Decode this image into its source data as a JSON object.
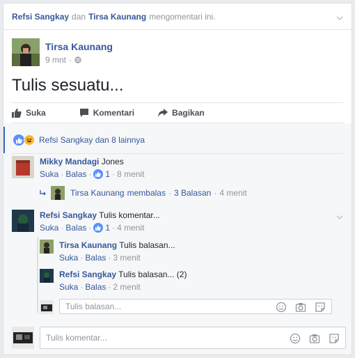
{
  "notification": {
    "user1": "Refsi Sangkay",
    "conj": "dan",
    "user2": "Tirsa Kaunang",
    "text": "mengomentari ini."
  },
  "post": {
    "author": "Tirsa Kaunang",
    "time": "9 mnt",
    "text": "Tulis sesuatu...",
    "actions": {
      "like": "Suka",
      "comment": "Komentari",
      "share": "Bagikan"
    }
  },
  "reactions": {
    "text": "Refsi Sangkay dan 8 lainnya"
  },
  "comments": [
    {
      "name": "Mikky Mandagi",
      "text": "Jones",
      "like": "Suka",
      "reply": "Balas",
      "likes": "1",
      "time": "8 menit",
      "thread": {
        "name": "Tirsa Kaunang",
        "action": "membalas",
        "replies": "3 Balasan",
        "time": "4 menit"
      }
    },
    {
      "name": "Refsi Sangkay",
      "text": "Tulis komentar...",
      "like": "Suka",
      "reply": "Balas",
      "likes": "1",
      "time": "4 menit",
      "replies": [
        {
          "name": "Tirsa Kaunang",
          "text": "Tulis balasan...",
          "like": "Suka",
          "reply": "Balas",
          "time": "3 menit"
        },
        {
          "name": "Refsi Sangkay",
          "text": "Tulis balasan... (2)",
          "like": "Suka",
          "reply": "Balas",
          "time": "2 menit"
        }
      ],
      "reply_placeholder": "Tulis balasan..."
    }
  ],
  "comment_input": {
    "placeholder": "Tulis komentar..."
  },
  "sep_dot": "·",
  "colors": {
    "link": "#365899",
    "muted": "#90949c",
    "accent": "#4267b2",
    "like": "#5890ff"
  }
}
